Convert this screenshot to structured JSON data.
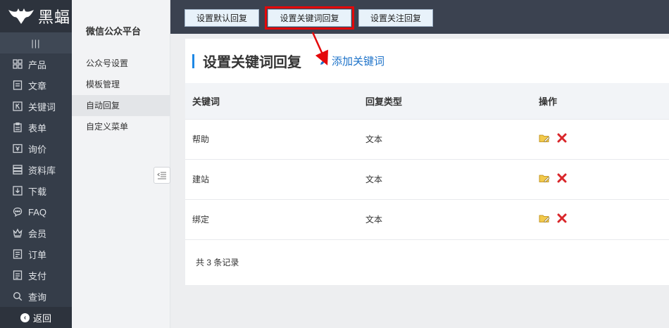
{
  "brand": {
    "name": "黑蝠"
  },
  "sidebar": {
    "collapse_label": "|||",
    "items": [
      {
        "label": "产品",
        "icon": "grid-icon"
      },
      {
        "label": "文章",
        "icon": "article-icon"
      },
      {
        "label": "关键词",
        "icon": "keyword-icon"
      },
      {
        "label": "表单",
        "icon": "form-icon"
      },
      {
        "label": "询价",
        "icon": "inquiry-icon"
      },
      {
        "label": "资料库",
        "icon": "database-icon"
      },
      {
        "label": "下载",
        "icon": "download-icon"
      },
      {
        "label": "FAQ",
        "icon": "faq-icon"
      },
      {
        "label": "会员",
        "icon": "crown-icon"
      },
      {
        "label": "订单",
        "icon": "order-icon"
      },
      {
        "label": "支付",
        "icon": "payment-icon"
      },
      {
        "label": "查询",
        "icon": "search-icon"
      }
    ],
    "back_label": "返回"
  },
  "subnav": {
    "title": "微信公众平台",
    "items": [
      "公众号设置",
      "模板管理",
      "自动回复",
      "自定义菜单"
    ],
    "active_index": 2
  },
  "toolbar": {
    "buttons": [
      "设置默认回复",
      "设置关键词回复",
      "设置关注回复"
    ],
    "active_index": 1
  },
  "panel": {
    "heading": "设置关键词回复",
    "add_link": "添加关键词",
    "columns": [
      "关键词",
      "回复类型",
      "操作"
    ],
    "rows": [
      {
        "keyword": "帮助",
        "type": "文本"
      },
      {
        "keyword": "建站",
        "type": "文本"
      },
      {
        "keyword": "绑定",
        "type": "文本"
      }
    ],
    "footer": "共 3 条记录"
  },
  "colors": {
    "sidebar_bg": "#353d49",
    "topbar_bg": "#3b4250",
    "accent_blue": "#1e88e5",
    "highlight_red": "#e4080a"
  }
}
